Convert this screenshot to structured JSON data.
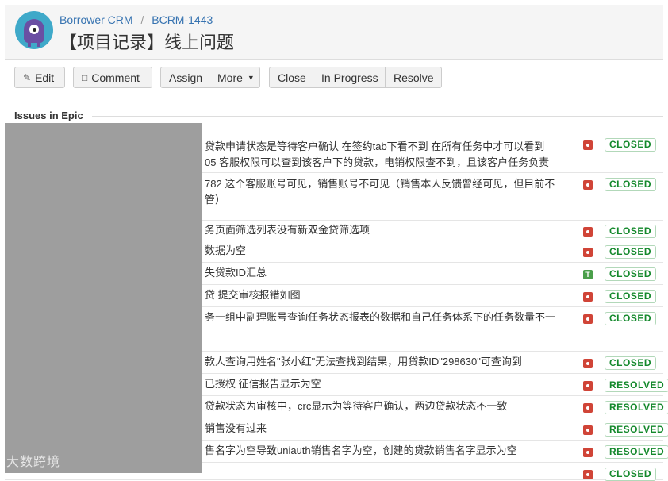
{
  "breadcrumb": {
    "project": "Borrower CRM",
    "separator": "/",
    "issue_key": "BCRM-1443"
  },
  "title": "【项目记录】线上问题",
  "toolbar": {
    "edit": "Edit",
    "comment": "Comment",
    "assign": "Assign",
    "more": "More",
    "close": "Close",
    "in_progress": "In Progress",
    "resolve": "Resolve"
  },
  "section": {
    "title": "Issues in Epic"
  },
  "issues": [
    {
      "summary": "贷款申请状态是等待客户确认 在签约tab下看不到 在所有任务中才可以看到\n05 客服权限可以查到该客户下的贷款，电销权限查不到，且该客户任务负责",
      "type": "bug",
      "status": "CLOSED"
    },
    {
      "summary": "782 这个客服账号可见，销售账号不可见（销售本人反馈曾经可见，但目前不\n管）",
      "type": "bug",
      "status": "CLOSED"
    },
    {
      "summary": "务页面筛选列表没有新双金贷筛选项",
      "type": "bug",
      "status": "CLOSED"
    },
    {
      "summary": "数据为空",
      "type": "bug",
      "status": "CLOSED"
    },
    {
      "summary": "失贷款ID汇总",
      "type": "task",
      "status": "CLOSED"
    },
    {
      "summary": "贷 提交审核报错如图",
      "type": "bug",
      "status": "CLOSED"
    },
    {
      "summary": "务一组中副理账号查询任务状态报表的数据和自己任务体系下的任务数量不一",
      "type": "bug",
      "status": "CLOSED"
    },
    {
      "summary": "款人查询用姓名\"张小红\"无法查找到结果，用贷款ID\"298630\"可查询到",
      "type": "bug",
      "status": "CLOSED"
    },
    {
      "summary": "已授权 征信报告显示为空",
      "type": "bug",
      "status": "RESOLVED"
    },
    {
      "summary": "贷款状态为审核中，crc显示为等待客户确认，两边贷款状态不一致",
      "type": "bug",
      "status": "RESOLVED"
    },
    {
      "summary": "销售没有过来",
      "type": "bug",
      "status": "RESOLVED"
    },
    {
      "summary": "售名字为空导致uniauth销售名字为空，创建的贷款销售名字显示为空",
      "type": "bug",
      "status": "RESOLVED"
    },
    {
      "summary": "",
      "type": "bug",
      "status": "CLOSED"
    }
  ],
  "task_icon_letter": "T",
  "watermark": "大数跨境",
  "colors": {
    "link": "#3572b0",
    "closed_green": "#14892c",
    "bug_red": "#d04437",
    "task_green": "#4a9f4a",
    "redaction": "#9e9e9e"
  }
}
